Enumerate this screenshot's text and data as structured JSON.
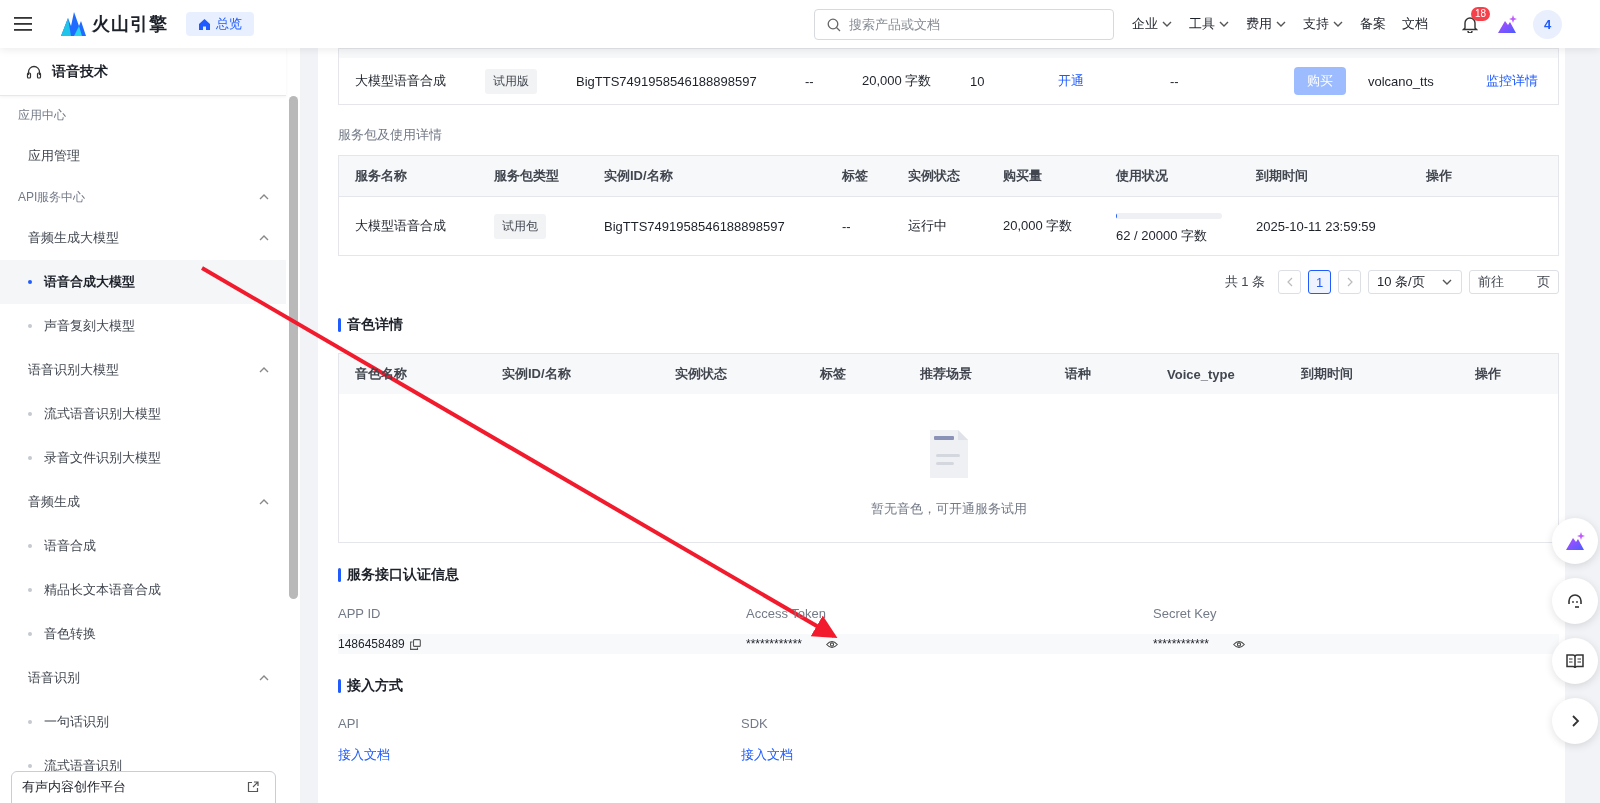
{
  "top_bar": {
    "logo_text": "火山引擎",
    "home_tab": "总览",
    "search": {
      "placeholder": "搜索产品或文档"
    },
    "menu": [
      {
        "label": "企业",
        "kind": "dropdown"
      },
      {
        "label": "工具",
        "kind": "dropdown"
      },
      {
        "label": "费用",
        "kind": "dropdown"
      },
      {
        "label": "支持",
        "kind": "dropdown"
      },
      {
        "label": "备案",
        "kind": "link"
      },
      {
        "label": "文档",
        "kind": "link"
      }
    ],
    "notification_badge": "18",
    "avatar": "4"
  },
  "sidebar": {
    "title": "语音技术",
    "items": [
      {
        "label": "应用中心",
        "children": [
          {
            "label": "应用管理",
            "selected": false
          }
        ]
      },
      {
        "label": "API服务中心",
        "expanded": true,
        "children": [
          {
            "label": "音频生成大模型",
            "expanded": true,
            "children": [
              {
                "label": "语音合成大模型",
                "selected": true
              },
              {
                "label": "声音复刻大模型",
                "selected": false
              }
            ]
          },
          {
            "label": "语音识别大模型",
            "expanded": true,
            "children": [
              {
                "label": "流式语音识别大模型",
                "selected": false
              },
              {
                "label": "录音文件识别大模型",
                "selected": false
              }
            ]
          },
          {
            "label": "音频生成",
            "expanded": true,
            "children": [
              {
                "label": "语音合成",
                "selected": false
              },
              {
                "label": "精品长文本语音合成",
                "selected": false
              },
              {
                "label": "音色转换",
                "selected": false
              }
            ]
          },
          {
            "label": "语音识别",
            "expanded": true,
            "children": [
              {
                "label": "一句话识别",
                "selected": false
              },
              {
                "label": "流式语音识别",
                "selected": false
              }
            ]
          }
        ]
      }
    ],
    "platform_link": "有声内容创作平台"
  },
  "instance_table": {
    "rows": [
      {
        "cells": [
          {
            "kind": "text",
            "text": "大模型语音合成"
          },
          {
            "kind": "tag",
            "text": "试用版"
          },
          {
            "kind": "text",
            "text": "BigTTS7491958546188898597"
          },
          {
            "kind": "text",
            "text": "--"
          },
          {
            "kind": "text",
            "text": "20,000 字数"
          },
          {
            "kind": "text",
            "text": "10"
          },
          {
            "kind": "link",
            "text": "开通"
          },
          {
            "kind": "text",
            "text": "--"
          },
          {
            "kind": "button",
            "text": "购买",
            "disabled": true
          },
          {
            "kind": "text",
            "text": "volcano_tts"
          },
          {
            "kind": "link",
            "text": "监控详情"
          }
        ]
      }
    ]
  },
  "package_section": {
    "title": "服务包及使用详情",
    "columns": [
      "服务名称",
      "服务包类型",
      "实例ID/名称",
      "标签",
      "实例状态",
      "购买量",
      "使用状况",
      "到期时间",
      "操作"
    ],
    "rows": [
      {
        "cells": [
          {
            "kind": "text",
            "text": "大模型语音合成"
          },
          {
            "kind": "tag",
            "text": "试用包"
          },
          {
            "kind": "text",
            "text": "BigTTS7491958546188898597"
          },
          {
            "kind": "text",
            "text": "--"
          },
          {
            "kind": "text",
            "text": "运行中"
          },
          {
            "kind": "text",
            "text": "20,000 字数"
          },
          {
            "kind": "usage",
            "level": 0.0031,
            "text": "62 / 20000 字数"
          },
          {
            "kind": "text",
            "text": "2025-10-11 23:59:59"
          }
        ]
      }
    ],
    "pagination": {
      "total": "共 1 条",
      "pages": [
        {
          "label": "1",
          "selected": true
        }
      ],
      "page_size": "10 条/页",
      "jump_label": "前往",
      "jump_suffix": "页"
    }
  },
  "voice_section": {
    "title": "音色详情",
    "columns": [
      "音色名称",
      "实例ID/名称",
      "实例状态",
      "标签",
      "推荐场景",
      "语种",
      "Voice_type",
      "到期时间",
      "操作"
    ],
    "empty_text": "暂无音色，可开通服务试用"
  },
  "credentials_section": {
    "title": "服务接口认证信息",
    "fields": [
      {
        "label": "APP ID",
        "value": "1486458489",
        "kind": "copy"
      },
      {
        "label": "Access Token",
        "value": "************",
        "kind": "secret"
      },
      {
        "label": "Secret Key",
        "value": "************",
        "kind": "secret"
      }
    ]
  },
  "access_section": {
    "title": "接入方式",
    "items": [
      {
        "label": "API",
        "link": "接入文档"
      },
      {
        "label": "SDK",
        "link": "接入文档"
      }
    ]
  }
}
